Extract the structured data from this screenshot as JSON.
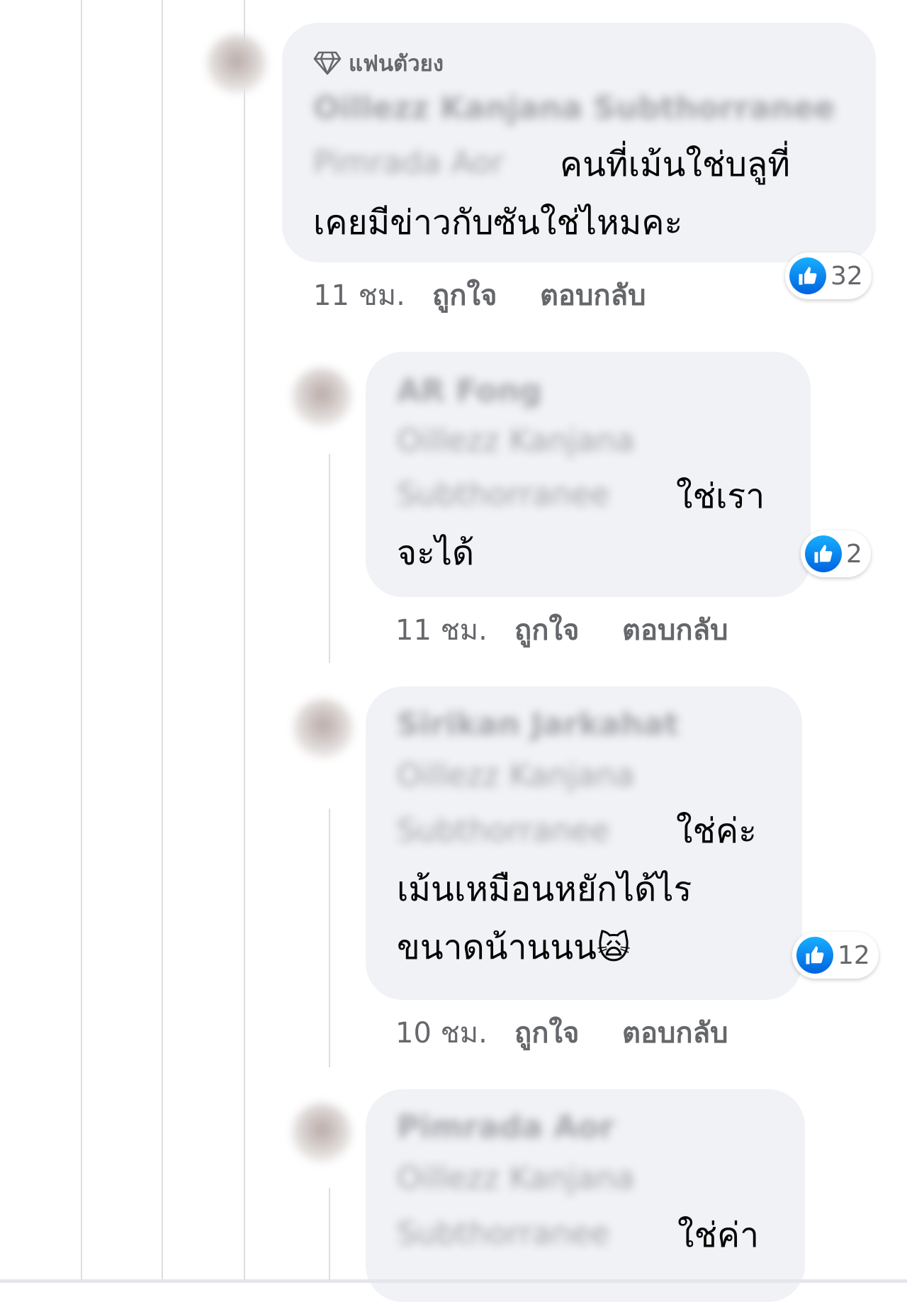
{
  "colors": {
    "bubble": "#f0f2f5",
    "meta": "#65676b",
    "like_blue": "#0866ff",
    "rail": "#dcdee3"
  },
  "comments": [
    {
      "badge": {
        "icon": "diamond-icon",
        "label": "แฟนตัวยง"
      },
      "name_blurred": "Oillezz Kanjana Subthorranee",
      "mention_blurred": "Pimrada Aor",
      "text_lines": [
        "คนที่เม้นใช่บลูที่",
        "เคยมีข่าวกับซันใช่ไหมคะ"
      ],
      "time": "11 ชม.",
      "like_label": "ถูกใจ",
      "reply_label": "ตอบกลับ",
      "reaction_count": "32"
    },
    {
      "name_blurred": "AR Fong",
      "mention_blurred_lines": [
        "Oillezz Kanjana",
        "Subthorranee"
      ],
      "text_lines": [
        "ใช่เรา",
        "จะได้"
      ],
      "time": "11 ชม.",
      "like_label": "ถูกใจ",
      "reply_label": "ตอบกลับ",
      "reaction_count": "2"
    },
    {
      "name_blurred": "Sirikan Jarkahat",
      "mention_blurred_lines": [
        "Oillezz Kanjana",
        "Subthorranee"
      ],
      "text_lines": [
        "ใช่ค่ะ",
        "เม้นเหมือนหยักได้ไร",
        "ขนาดน้านนน"
      ],
      "emoji": "🙀",
      "time": "10 ชม.",
      "like_label": "ถูกใจ",
      "reply_label": "ตอบกลับ",
      "reaction_count": "12"
    },
    {
      "name_blurred": "Pimrada Aor",
      "mention_blurred_lines": [
        "Oillezz Kanjana",
        "Subthorranee"
      ],
      "text_lines": [
        "ใช่ค่า"
      ]
    }
  ]
}
